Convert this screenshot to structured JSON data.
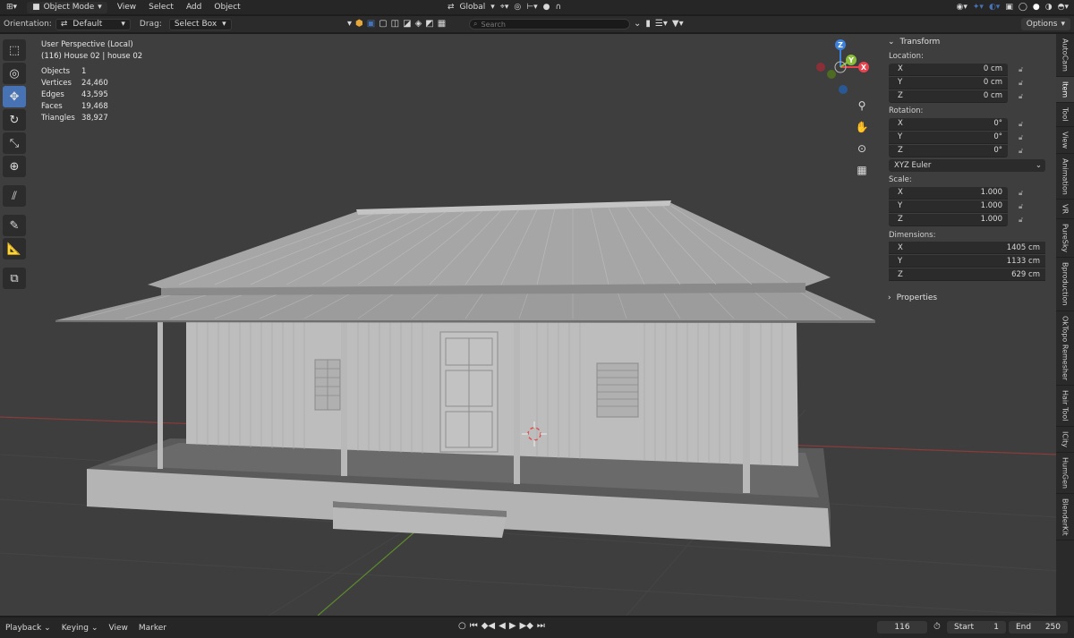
{
  "header": {
    "mode": "Object Mode",
    "menus": [
      "View",
      "Select",
      "Add",
      "Object"
    ],
    "transform_space": "Global"
  },
  "toolrow": {
    "orientation_label": "Orientation:",
    "orientation_value": "Default",
    "drag_label": "Drag:",
    "drag_value": "Select Box",
    "search_placeholder": "Search",
    "options_label": "Options"
  },
  "overlay": {
    "perspective": "User Perspective (Local)",
    "object_line": "(116) House 02 | house 02",
    "stats": [
      {
        "label": "Objects",
        "value": "1"
      },
      {
        "label": "Vertices",
        "value": "24,460"
      },
      {
        "label": "Edges",
        "value": "43,595"
      },
      {
        "label": "Faces",
        "value": "19,468"
      },
      {
        "label": "Triangles",
        "value": "38,927"
      }
    ]
  },
  "gizmo": {
    "x": "X",
    "y": "Y",
    "z": "Z"
  },
  "npanel": {
    "transform_title": "Transform",
    "location_label": "Location:",
    "location": [
      {
        "axis": "X",
        "value": "0 cm"
      },
      {
        "axis": "Y",
        "value": "0 cm"
      },
      {
        "axis": "Z",
        "value": "0 cm"
      }
    ],
    "rotation_label": "Rotation:",
    "rotation": [
      {
        "axis": "X",
        "value": "0°"
      },
      {
        "axis": "Y",
        "value": "0°"
      },
      {
        "axis": "Z",
        "value": "0°"
      }
    ],
    "rotation_mode": "XYZ Euler",
    "scale_label": "Scale:",
    "scale": [
      {
        "axis": "X",
        "value": "1.000"
      },
      {
        "axis": "Y",
        "value": "1.000"
      },
      {
        "axis": "Z",
        "value": "1.000"
      }
    ],
    "dimensions_label": "Dimensions:",
    "dimensions": [
      {
        "axis": "X",
        "value": "1405 cm"
      },
      {
        "axis": "Y",
        "value": "1133 cm"
      },
      {
        "axis": "Z",
        "value": "629 cm"
      }
    ],
    "properties_title": "Properties"
  },
  "sidetabs": [
    "AutoCam",
    "Item",
    "Tool",
    "View",
    "Animation",
    "VR",
    "PureSky",
    "Bproduction",
    "OkTopo Remesher",
    "Hair Tool",
    "ICity",
    "HumGen",
    "BlenderKit"
  ],
  "timeline": {
    "menus": [
      "Playback",
      "Keying",
      "View",
      "Marker"
    ],
    "current_frame": "116",
    "start_label": "Start",
    "start_value": "1",
    "end_label": "End",
    "end_value": "250"
  },
  "colors": {
    "accent": "#4772b3",
    "axis_x": "#e8434f",
    "axis_y": "#8bbd3a",
    "axis_z": "#3c81db",
    "viewport_bg": "#3e3e3e"
  }
}
